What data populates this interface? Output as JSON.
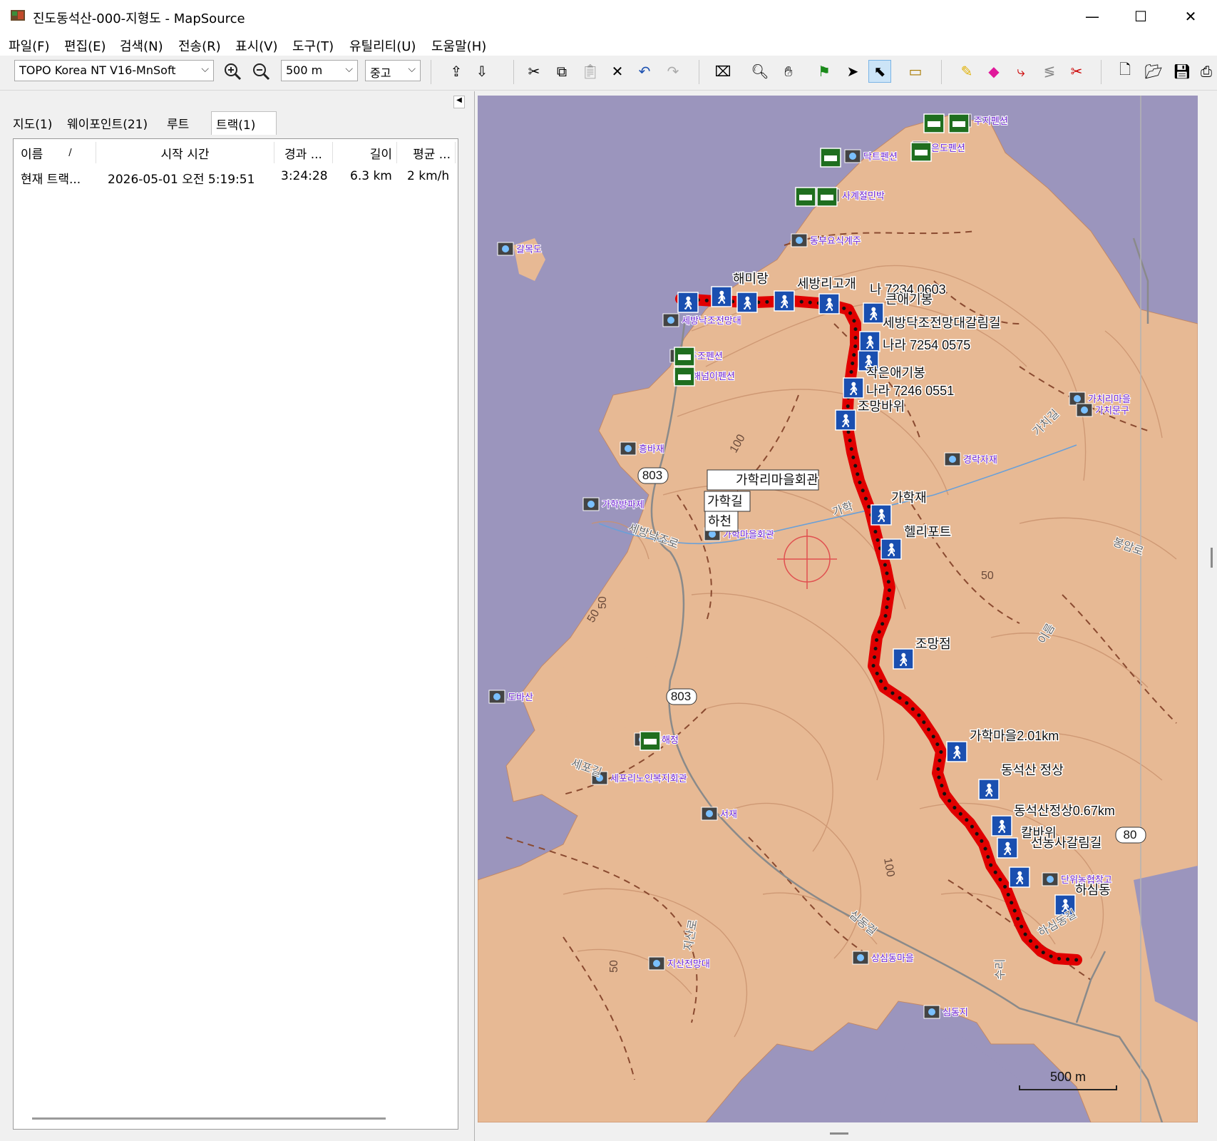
{
  "window": {
    "title": "진도동석산-000-지형도 - MapSource",
    "minimize": "—",
    "maximize": "☐",
    "close": "✕"
  },
  "menu": [
    "파일(F)",
    "편집(E)",
    "검색(N)",
    "전송(R)",
    "표시(V)",
    "도구(T)",
    "유틸리티(U)",
    "도움말(H)"
  ],
  "toolbar": {
    "map_product": "TOPO Korea NT V16-MnSoft",
    "zoom_scale": "500 m",
    "detail_level": "중고"
  },
  "tabs": [
    "지도(1)",
    "웨이포인트(21)",
    "루트",
    "트랙(1)"
  ],
  "track_table": {
    "columns": [
      "이름",
      "/",
      "시작 시간",
      "경과 ...",
      "길이",
      "평균 ..."
    ],
    "rows": [
      [
        "현재 트랙...",
        "2026-05-01 오전 5:19:51",
        "3:24:28",
        "6.3 km",
        "2 km/h"
      ]
    ]
  },
  "map": {
    "scale_label": "500 m",
    "route_labels": [
      "803",
      "803",
      "80"
    ],
    "contour_labels": [
      "100",
      "50",
      "50",
      "50",
      "100",
      "50"
    ],
    "waypoint_labels": [
      "해미랑",
      "세방리고개",
      "나 7234 0603",
      "큰애기봉",
      "세방닥조전망대갈림길",
      "나라 7254 0575",
      "작은애기봉",
      "나라 7246 0551",
      "조망바위",
      "가학리마을회관",
      "가학길",
      "하천",
      "가학재",
      "헬리포트",
      "조망점",
      "가학마을2.01km",
      "동석산 정상",
      "동석산정상0.67km",
      "칼바위",
      "선농사갈림길",
      "하심동"
    ],
    "poi_labels": [
      "주지펜션",
      "닥트펜션",
      "은도펜션",
      "사계절민박",
      "동부요식계주",
      "갈목도",
      "세방낙조전망대",
      "주조펜션",
      "해넘이펜션",
      "가치리마을",
      "가치문구",
      "경락자재",
      "흥바재",
      "가학방파제",
      "가학마을회관",
      "도바산",
      "소해정",
      "세포리노인복지회관",
      "서재",
      "단위농협창고",
      "상심동마을",
      "지산전망대",
      "심동지"
    ],
    "road_labels": [
      "세방낙조로",
      "세포길",
      "가치길",
      "봉암로",
      "지산로",
      "심동길",
      "수리",
      "하심동길",
      "이름",
      "가학"
    ],
    "colors": {
      "water": "#9b95bd",
      "land": "#e7b994",
      "track": "#e00000",
      "waypoint_bg": "#1a4fb0",
      "poi_text": "#6b20d0"
    }
  }
}
